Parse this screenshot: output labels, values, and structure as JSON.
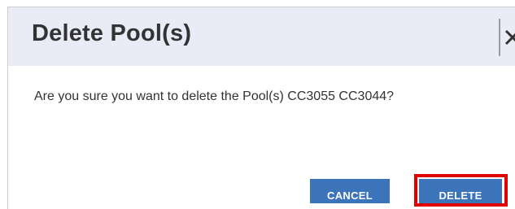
{
  "dialog": {
    "title": "Delete Pool(s)",
    "message": "Are you sure you want to delete the Pool(s) CC3055 CC3044?",
    "close_icon": "close-icon",
    "buttons": {
      "cancel_label": "CANCEL",
      "delete_label": "DELETE"
    }
  },
  "colors": {
    "header_background": "#e9ecf7",
    "button_primary": "#3b74b8",
    "highlight": "#e00000"
  }
}
